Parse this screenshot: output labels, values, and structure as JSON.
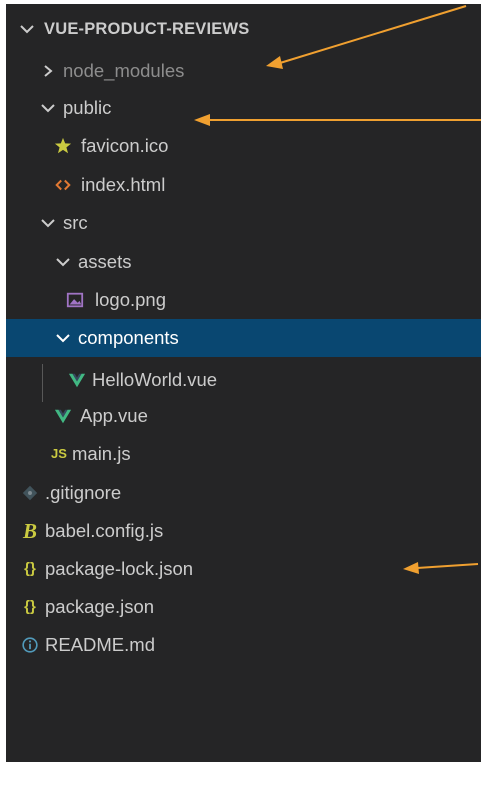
{
  "explorer": {
    "project_title": "VUE-PRODUCT-REVIEWS",
    "items": [
      {
        "label": "node_modules",
        "kind": "folder",
        "state": "collapsed"
      },
      {
        "label": "public",
        "kind": "folder",
        "state": "expanded"
      },
      {
        "label": "favicon.ico",
        "kind": "file",
        "icon": "favicon-star-icon"
      },
      {
        "label": "index.html",
        "kind": "file",
        "icon": "html-icon"
      },
      {
        "label": "src",
        "kind": "folder",
        "state": "expanded"
      },
      {
        "label": "assets",
        "kind": "folder",
        "state": "expanded"
      },
      {
        "label": "logo.png",
        "kind": "file",
        "icon": "image-icon"
      },
      {
        "label": "components",
        "kind": "folder",
        "state": "expanded",
        "selected": true
      },
      {
        "label": "HelloWorld.vue",
        "kind": "file",
        "icon": "vue-icon"
      },
      {
        "label": "App.vue",
        "kind": "file",
        "icon": "vue-icon"
      },
      {
        "label": "main.js",
        "kind": "file",
        "icon": "js-icon",
        "icon_text": "JS"
      },
      {
        "label": ".gitignore",
        "kind": "file",
        "icon": "gitignore-icon"
      },
      {
        "label": "babel.config.js",
        "kind": "file",
        "icon": "babel-icon",
        "icon_text": "B"
      },
      {
        "label": "package-lock.json",
        "kind": "file",
        "icon": "json-icon",
        "icon_text": "{}"
      },
      {
        "label": "package.json",
        "kind": "file",
        "icon": "json-icon",
        "icon_text": "{}"
      },
      {
        "label": "README.md",
        "kind": "file",
        "icon": "info-icon"
      }
    ]
  },
  "colors": {
    "panel_background": "#252526",
    "selection_background": "#094771",
    "text": "#cccccc",
    "muted_text": "#8d8d8d",
    "annotation_arrow": "#f0a030",
    "vue_green": "#41b883",
    "json_yellow": "#cbcb41",
    "html_orange": "#e37933",
    "image_purple": "#a074c4"
  }
}
